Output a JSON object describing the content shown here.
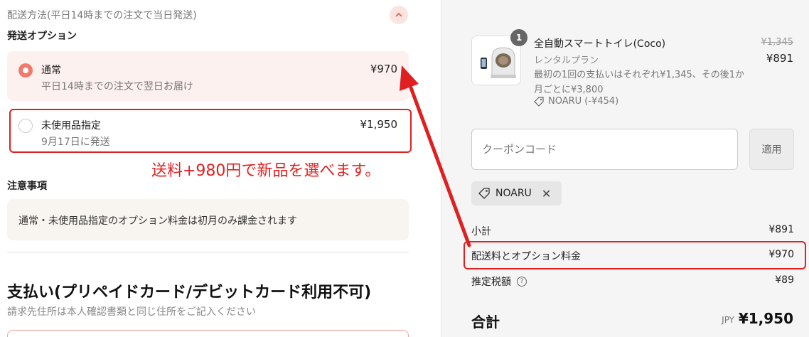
{
  "shipping": {
    "header": "配送方法(平日14時までの注文で当日発送)",
    "options_title": "発送オプション",
    "options": [
      {
        "name": "通常",
        "sub": "平日14時までの注文で翌日お届け",
        "price": "¥970",
        "selected": true
      },
      {
        "name": "未使用品指定",
        "sub": "9月17日に発送",
        "price": "¥1,950",
        "selected": false
      }
    ],
    "annotation": "送料+980円で新品を選べます。",
    "notice_title": "注意事項",
    "notice_text": "通常・未使用品指定のオプション料金は初月のみ課金されます"
  },
  "payment": {
    "title": "支払い(プリペイドカード/デビットカード利用不可)",
    "subtitle": "請求先住所は本人確認書類と同じ住所をご記入ください"
  },
  "summary": {
    "quantity": "1",
    "product_name": "全自動スマートトイレ(Coco)",
    "variant": "レンタルプラン",
    "description": "最初の1回の支払いはそれぞれ¥1,345、その後1か月ごとに¥3,800",
    "discount": "NOARU (-¥454)",
    "price_old": "¥1,345",
    "price_new": "¥891",
    "coupon_placeholder": "クーポンコード",
    "apply_label": "適用",
    "applied_code": "NOARU",
    "subtotal_label": "小計",
    "subtotal_value": "¥891",
    "shipping_label": "配送料とオプション料金",
    "shipping_value": "¥970",
    "tax_label": "推定税額",
    "tax_value": "¥89",
    "total_label": "合計",
    "currency": "JPY",
    "total_value": "¥1,950"
  },
  "colors": {
    "accent": "#ef7a6e",
    "annotation_red": "#e02020"
  }
}
